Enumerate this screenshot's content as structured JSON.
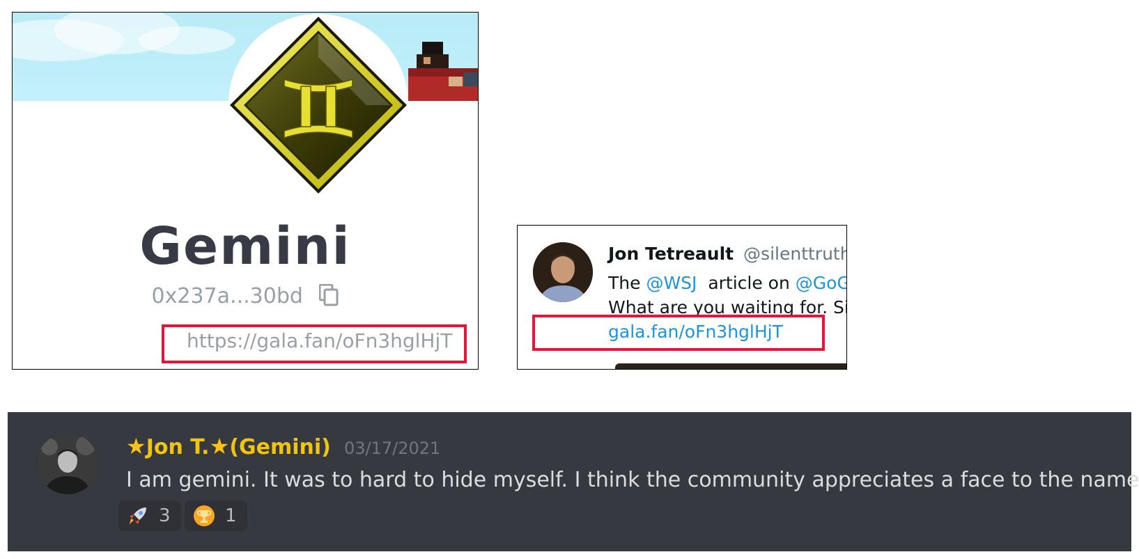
{
  "profile": {
    "name": "Gemini",
    "address": "0x237a...30bd",
    "link": "https://gala.fan/oFn3hglHjT",
    "icons": [
      "gemini-zodiac-icon",
      "copy-icon"
    ]
  },
  "tweet": {
    "author": "Jon Tetreault",
    "handle": "@silenttruthsp",
    "line1_prefix": "The ",
    "mention1": "@WSJ",
    "line1_mid": "  article on ",
    "mention2": "@GoGa",
    "line2": "What are you waiting for. Sig",
    "link": "gala.fan/oFn3hglHjT"
  },
  "discord": {
    "username": "Jon T.",
    "role_suffix": "(Gemini)",
    "timestamp": "03/17/2021",
    "message": "I am gemini. It was to hard to hide myself. I think the community appreciates a face to the name",
    "reactions": [
      {
        "emoji": "rocket-icon",
        "count": "3"
      },
      {
        "emoji": "trophy-icon",
        "count": "1"
      }
    ],
    "colors": {
      "background": "#36393f",
      "username": "#f1c40f",
      "text": "#dcddde"
    }
  },
  "highlight_color": "#e0163b"
}
